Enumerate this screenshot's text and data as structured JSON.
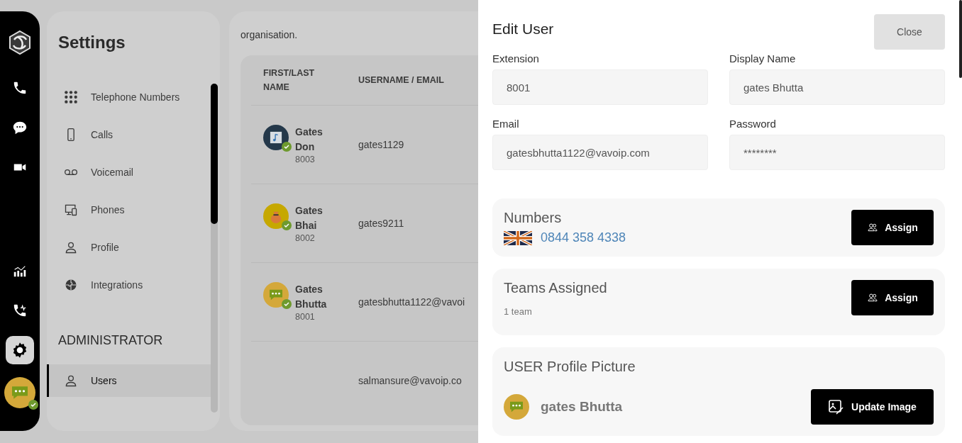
{
  "rail": {
    "nav": [
      {
        "kind": "phone",
        "selected": false
      },
      {
        "kind": "chat",
        "selected": false
      },
      {
        "kind": "video",
        "selected": false
      },
      {
        "kind": "stats",
        "selected": false
      },
      {
        "kind": "call-activity",
        "selected": false
      },
      {
        "kind": "settings",
        "selected": true
      }
    ],
    "online": true
  },
  "settings": {
    "title": "Settings",
    "items": [
      {
        "label": "Telephone Numbers",
        "kind": "grid",
        "selected": false
      },
      {
        "label": "Calls",
        "kind": "mobile",
        "selected": false
      },
      {
        "label": "Voicemail",
        "kind": "voicemail",
        "selected": false
      },
      {
        "label": "Phones",
        "kind": "devices",
        "selected": false
      },
      {
        "label": "Profile",
        "kind": "person",
        "selected": false
      },
      {
        "label": "Integrations",
        "kind": "puzzle",
        "selected": false
      }
    ],
    "admin_heading": "ADMINISTRATOR",
    "admin_items": [
      {
        "label": "Users",
        "kind": "person",
        "selected": true
      }
    ]
  },
  "users": {
    "intro": "organisation.",
    "columns": [
      "FIRST/LAST NAME",
      "USERNAME / EMAIL"
    ],
    "rows": [
      {
        "first_name": "Gates",
        "last_name": "Don",
        "extension": "8003",
        "username": "gates1129",
        "kind": "music",
        "online": true
      },
      {
        "first_name": "Gates",
        "last_name": "Bhai",
        "extension": "8002",
        "username": "gates9211",
        "kind": "bag",
        "online": true
      },
      {
        "first_name": "Gates",
        "last_name": "Bhutta",
        "extension": "8001",
        "username": "gatesbhutta1122@vavoi",
        "kind": "chat",
        "online": true
      },
      {
        "username": "salmansure@vavoip.co"
      }
    ]
  },
  "edit_user": {
    "title": "Edit User",
    "close": "Close",
    "fields": [
      {
        "label": "Extension",
        "value": "8001"
      },
      {
        "label": "Display Name",
        "value": "gates Bhutta"
      },
      {
        "label": "Email",
        "value": "gatesbhutta1122@vavoip.com"
      },
      {
        "label": "Password",
        "value": "********"
      }
    ],
    "numbers": {
      "title": "Numbers",
      "items": [
        {
          "number": "0844 358 4338"
        }
      ],
      "button": "Assign"
    },
    "teams": {
      "title": "Teams Assigned",
      "count": "1 team",
      "button": "Assign"
    },
    "picture": {
      "title": "USER Profile Picture",
      "name": "gates Bhutta",
      "kind": "chat",
      "button": "Update Image"
    }
  }
}
